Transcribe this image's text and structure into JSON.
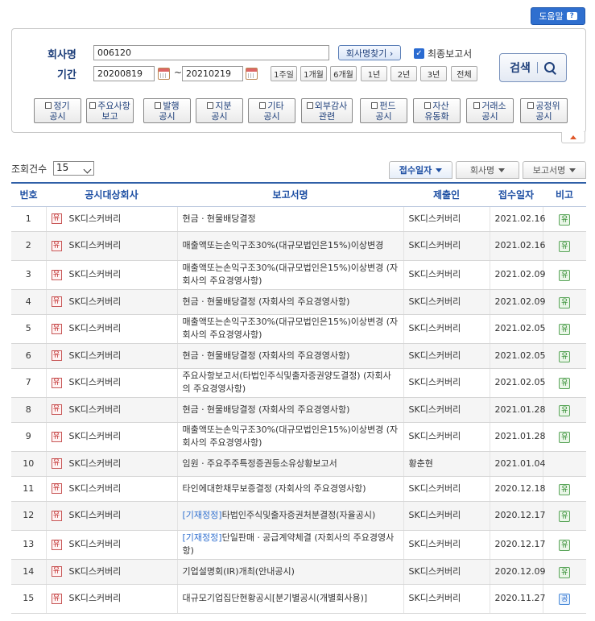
{
  "help": {
    "label": "도움말",
    "icon": "question-icon"
  },
  "search": {
    "company_label": "회사명",
    "company_value": "006120",
    "find_company_btn": "회사명찾기 ›",
    "final_report_label": "최종보고서",
    "period_label": "기간",
    "start_date": "20200819",
    "end_date": "20210219",
    "date_sep": "~",
    "periods": [
      "1주일",
      "1개월",
      "6개월",
      "1년",
      "2년",
      "3년",
      "전체"
    ],
    "search_btn": "검색"
  },
  "categories": [
    [
      "정기",
      "공시"
    ],
    [
      "주요사항",
      "보고"
    ],
    [
      "발행",
      "공시"
    ],
    [
      "지분",
      "공시"
    ],
    [
      "기타",
      "공시"
    ],
    [
      "외부감사",
      "관련"
    ],
    [
      "펀드",
      "공시"
    ],
    [
      "자산",
      "유동화"
    ],
    [
      "거래소",
      "공시"
    ],
    [
      "공정위",
      "공시"
    ]
  ],
  "list": {
    "count_label": "조회건수",
    "count_value": "15",
    "sort": [
      "접수일자",
      "회사명",
      "보고서명"
    ]
  },
  "table": {
    "headers": [
      "번호",
      "공시대상회사",
      "보고서명",
      "제출인",
      "접수일자",
      "비고"
    ],
    "rows": [
      {
        "no": "1",
        "cls": "유",
        "corp": "SK디스커버리",
        "prefix": "",
        "report": "현금ㆍ현물배당결정",
        "filer": "SK디스커버리",
        "date": "2021.02.16",
        "note": "유"
      },
      {
        "no": "2",
        "cls": "유",
        "corp": "SK디스커버리",
        "prefix": "",
        "report": "매출액또는손익구조30%(대규모법인은15%)이상변경",
        "filer": "SK디스커버리",
        "date": "2021.02.16",
        "note": "유"
      },
      {
        "no": "3",
        "cls": "유",
        "corp": "SK디스커버리",
        "prefix": "",
        "report": "매출액또는손익구조30%(대규모법인은15%)이상변경 (자회사의 주요경영사항)",
        "filer": "SK디스커버리",
        "date": "2021.02.09",
        "note": "유"
      },
      {
        "no": "4",
        "cls": "유",
        "corp": "SK디스커버리",
        "prefix": "",
        "report": "현금ㆍ현물배당결정 (자회사의 주요경영사항)",
        "filer": "SK디스커버리",
        "date": "2021.02.09",
        "note": "유"
      },
      {
        "no": "5",
        "cls": "유",
        "corp": "SK디스커버리",
        "prefix": "",
        "report": "매출액또는손익구조30%(대규모법인은15%)이상변경 (자회사의 주요경영사항)",
        "filer": "SK디스커버리",
        "date": "2021.02.05",
        "note": "유"
      },
      {
        "no": "6",
        "cls": "유",
        "corp": "SK디스커버리",
        "prefix": "",
        "report": "현금ㆍ현물배당결정 (자회사의 주요경영사항)",
        "filer": "SK디스커버리",
        "date": "2021.02.05",
        "note": "유"
      },
      {
        "no": "7",
        "cls": "유",
        "corp": "SK디스커버리",
        "prefix": "",
        "report": "주요사항보고서(타법인주식및출자증권양도결정) (자회사의 주요경영사항)",
        "filer": "SK디스커버리",
        "date": "2021.02.05",
        "note": "유"
      },
      {
        "no": "8",
        "cls": "유",
        "corp": "SK디스커버리",
        "prefix": "",
        "report": "현금ㆍ현물배당결정 (자회사의 주요경영사항)",
        "filer": "SK디스커버리",
        "date": "2021.01.28",
        "note": "유"
      },
      {
        "no": "9",
        "cls": "유",
        "corp": "SK디스커버리",
        "prefix": "",
        "report": "매출액또는손익구조30%(대규모법인은15%)이상변경 (자회사의 주요경영사항)",
        "filer": "SK디스커버리",
        "date": "2021.01.28",
        "note": "유"
      },
      {
        "no": "10",
        "cls": "유",
        "corp": "SK디스커버리",
        "prefix": "",
        "report": "임원ㆍ주요주주특정증권등소유상황보고서",
        "filer": "황춘현",
        "date": "2021.01.04",
        "note": ""
      },
      {
        "no": "11",
        "cls": "유",
        "corp": "SK디스커버리",
        "prefix": "",
        "report": "타인에대한채무보증결정 (자회사의 주요경영사항)",
        "filer": "SK디스커버리",
        "date": "2020.12.18",
        "note": "유"
      },
      {
        "no": "12",
        "cls": "유",
        "corp": "SK디스커버리",
        "prefix": "[기재정정]",
        "report": "타법인주식및출자증권처분결정(자율공시)",
        "filer": "SK디스커버리",
        "date": "2020.12.17",
        "note": "유"
      },
      {
        "no": "13",
        "cls": "유",
        "corp": "SK디스커버리",
        "prefix": "[기재정정]",
        "report": "단일판매ㆍ공급계약체결 (자회사의 주요경영사항)",
        "filer": "SK디스커버리",
        "date": "2020.12.17",
        "note": "유"
      },
      {
        "no": "14",
        "cls": "유",
        "corp": "SK디스커버리",
        "prefix": "",
        "report": "기업설명회(IR)개최(안내공시)",
        "filer": "SK디스커버리",
        "date": "2020.12.09",
        "note": "유"
      },
      {
        "no": "15",
        "cls": "유",
        "corp": "SK디스커버리",
        "prefix": "",
        "report": "대규모기업집단현황공시[분기별공시(개별회사용)]",
        "filer": "SK디스커버리",
        "date": "2020.11.27",
        "note": "공"
      }
    ]
  },
  "colors": {
    "accent": "#2f6fcf",
    "header_text": "#1e4fa3",
    "correction": "#2f6fcf"
  }
}
